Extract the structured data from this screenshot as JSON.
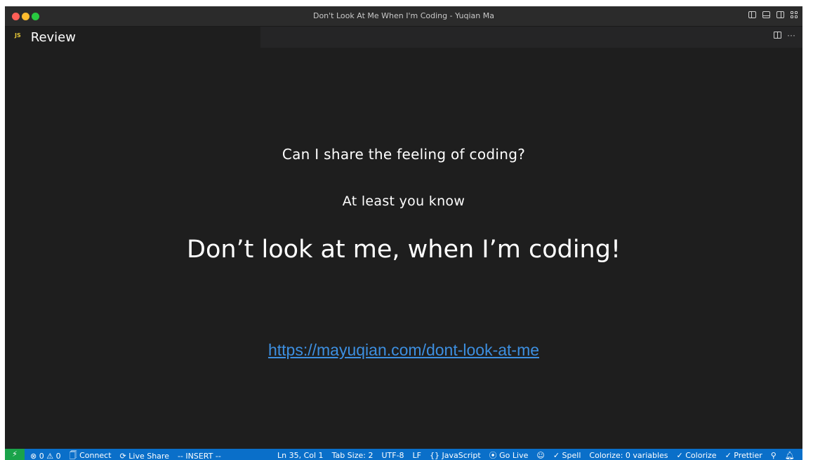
{
  "window": {
    "title": "Don't Look At Me When I'm Coding - Yuqian Ma"
  },
  "tab": {
    "icon_text": "JS",
    "label": "Review"
  },
  "content": {
    "line1": "Can I share the feeling of coding?",
    "line2": "At least you know",
    "headline": "Don’t look at me, when I’m coding!",
    "link": "https://mayuqian.com/dont-look-at-me"
  },
  "statusbar": {
    "remote_icon": "⚡",
    "problems": "⊗ 0 ⚠ 0",
    "connect": "🗍 Connect",
    "live_share": "⟳ Live Share",
    "mode": "-- INSERT --",
    "position": "Ln 35, Col 1",
    "tab_size": "Tab Size: 2",
    "encoding": "UTF-8",
    "eol": "LF",
    "language": "{} JavaScript",
    "go_live": "⦿ Go Live",
    "copilot": "☺",
    "spell": "✓ Spell",
    "colorize_vars": "Colorize: 0 variables",
    "colorize": "✓ Colorize",
    "prettier": "✓ Prettier",
    "feedback": "⚲",
    "bell": "🔔︎"
  },
  "colors": {
    "editor_bg": "#1e1e1e",
    "status_bg": "#0a6fc9",
    "remote_bg": "#1aa34a",
    "link": "#3d8fe0"
  }
}
